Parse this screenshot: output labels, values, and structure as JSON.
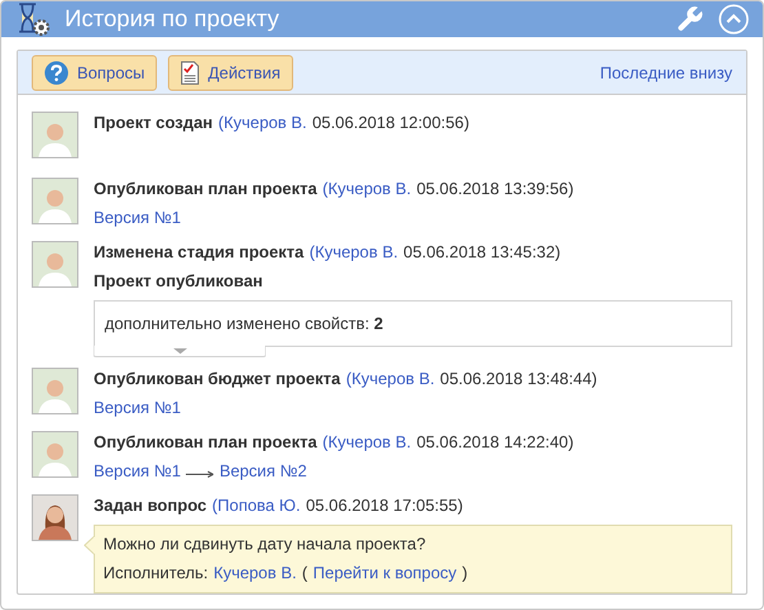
{
  "window": {
    "title": "История по проекту"
  },
  "toolbar": {
    "buttons": [
      {
        "kind": "questions",
        "label": "Вопросы"
      },
      {
        "kind": "actions",
        "label": "Действия"
      }
    ],
    "order_link": "Последние внизу"
  },
  "entries": [
    {
      "avatar": {
        "kind": "male"
      },
      "title": "Проект создан",
      "author": "(Кучеров В.",
      "date": "05.06.2018 12:00:56)"
    },
    {
      "avatar": {
        "kind": "male"
      },
      "title": "Опубликован план проекта",
      "author": "(Кучеров В.",
      "date": "05.06.2018 13:39:56)",
      "details": [
        {
          "kind": "links",
          "links": [
            "Версия №1"
          ]
        }
      ]
    },
    {
      "avatar": {
        "kind": "male"
      },
      "title": "Изменена стадия проекта",
      "author": "(Кучеров В.",
      "date": "05.06.2018 13:45:32)",
      "details": [
        {
          "kind": "status",
          "text": "Проект опубликован"
        },
        {
          "kind": "more",
          "text": "дополнительно изменено свойств: **2**"
        }
      ]
    },
    {
      "avatar": {
        "kind": "male"
      },
      "title": "Опубликован бюджет проекта",
      "author": "(Кучеров В.",
      "date": "05.06.2018 13:48:44)",
      "details": [
        {
          "kind": "links",
          "links": [
            "Версия №1"
          ]
        }
      ]
    },
    {
      "avatar": {
        "kind": "male"
      },
      "title": "Опубликован план проекта",
      "author": "(Кучеров В.",
      "date": "05.06.2018 14:22:40)",
      "details": [
        {
          "kind": "links",
          "links": [
            "Версия №1",
            "Версия №2"
          ]
        }
      ]
    },
    {
      "avatar": {
        "kind": "female"
      },
      "title": "Задан вопрос",
      "author": "(Попова Ю.",
      "date": "05.06.2018 17:05:55)",
      "details": [
        {
          "kind": "question",
          "text": "Можно ли сдвинуть дату начала проекта?",
          "executor_label": "Исполнитель:",
          "executor": "Кучеров В.",
          "goto_open": "(",
          "goto": "Перейти к вопросу",
          "goto_close": ")"
        }
      ]
    }
  ]
}
